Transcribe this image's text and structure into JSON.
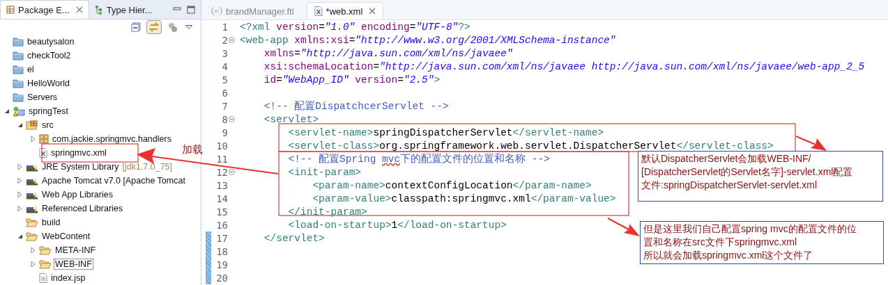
{
  "explorer": {
    "tabs": [
      {
        "label": "Package E...",
        "selected": true
      },
      {
        "label": "Type Hier...",
        "selected": false
      }
    ],
    "tree": [
      {
        "label": "beautysalon",
        "kind": "project"
      },
      {
        "label": "checkTool2",
        "kind": "project"
      },
      {
        "label": "el",
        "kind": "project"
      },
      {
        "label": "HelloWorld",
        "kind": "project"
      },
      {
        "label": "Servers",
        "kind": "project"
      },
      {
        "label": "springTest",
        "kind": "web-project",
        "expanded": true,
        "children": [
          {
            "label": "src",
            "kind": "source-folder",
            "expanded": true,
            "children": [
              {
                "label": "com.jackie.springmvc.handlers",
                "kind": "package",
                "expanded": false
              },
              {
                "label": "springmvc.xml",
                "kind": "xml-file"
              }
            ]
          },
          {
            "label": "JRE System Library",
            "decoration": "[jdk1.7.0_75]",
            "kind": "library",
            "expanded": false
          },
          {
            "label": "Apache Tomcat v7.0 [Apache Tomcat",
            "kind": "library",
            "expanded": false
          },
          {
            "label": "Web App Libraries",
            "kind": "library",
            "expanded": false
          },
          {
            "label": "Referenced Libraries",
            "kind": "library",
            "expanded": false
          },
          {
            "label": "build",
            "kind": "folder"
          },
          {
            "label": "WebContent",
            "kind": "folder",
            "expanded": true,
            "children": [
              {
                "label": "META-INF",
                "kind": "folder",
                "expanded": false
              },
              {
                "label": "WEB-INF",
                "kind": "folder",
                "expanded": false,
                "focused": true
              },
              {
                "label": "index.jsp",
                "kind": "jsp-file"
              }
            ]
          }
        ]
      }
    ]
  },
  "editor": {
    "tabs": [
      {
        "label": "brandManager.ftl",
        "selected": false,
        "kind": "ftl"
      },
      {
        "label": "*web.xml",
        "selected": true,
        "kind": "xml"
      }
    ],
    "lines": [
      {
        "number": "1",
        "tokens": [
          {
            "kind": "tag",
            "text": "<?xml"
          },
          {
            "kind": "attr",
            "text": " version"
          },
          {
            "kind": "text",
            "text": "="
          },
          {
            "kind": "value",
            "text": "\"1.0\""
          },
          {
            "kind": "attr",
            "text": " encoding"
          },
          {
            "kind": "text",
            "text": "="
          },
          {
            "kind": "value",
            "text": "\"UTF-8\""
          },
          {
            "kind": "tag",
            "text": "?>"
          }
        ]
      },
      {
        "number": "2",
        "fold": true,
        "tokens": [
          {
            "kind": "tag",
            "text": "<web-app"
          },
          {
            "kind": "attr",
            "text": " xmlns:xsi"
          },
          {
            "kind": "text",
            "text": "="
          },
          {
            "kind": "value",
            "text": "\"http://www.w3.org/2001/XMLSchema-instance\""
          }
        ]
      },
      {
        "number": "3",
        "tokens": [
          {
            "kind": "attr",
            "text": "    xmlns"
          },
          {
            "kind": "text",
            "text": "="
          },
          {
            "kind": "value",
            "text": "\"http://java.sun.com/xml/ns/javaee\""
          }
        ]
      },
      {
        "number": "4",
        "tokens": [
          {
            "kind": "attr",
            "text": "    xsi:schemaLocation"
          },
          {
            "kind": "text",
            "text": "="
          },
          {
            "kind": "value",
            "text": "\"http://java.sun.com/xml/ns/javaee http://java.sun.com/xml/ns/javaee/web-app_2_5"
          }
        ]
      },
      {
        "number": "5",
        "tokens": [
          {
            "kind": "attr",
            "text": "    id"
          },
          {
            "kind": "text",
            "text": "="
          },
          {
            "kind": "value",
            "text": "\"WebApp_ID\""
          },
          {
            "kind": "attr",
            "text": " version"
          },
          {
            "kind": "text",
            "text": "="
          },
          {
            "kind": "value",
            "text": "\"2.5\""
          },
          {
            "kind": "tag",
            "text": ">"
          }
        ]
      },
      {
        "number": "6"
      },
      {
        "number": "7",
        "tokens": [
          {
            "kind": "comment",
            "text": "    <!-- 配置DispatchcerServlet -->"
          }
        ]
      },
      {
        "number": "8",
        "fold": true,
        "tokens": [
          {
            "kind": "tag",
            "text": "    <servlet>"
          }
        ]
      },
      {
        "number": "9",
        "tokens": [
          {
            "kind": "tag",
            "text": "        <servlet-name>"
          },
          {
            "kind": "text",
            "text": "springDispatcherServlet"
          },
          {
            "kind": "tag",
            "text": "</servlet-name>"
          }
        ]
      },
      {
        "number": "10",
        "tokens": [
          {
            "kind": "tag",
            "text": "        <servlet-class>"
          },
          {
            "kind": "text",
            "text": "org.springframework.web.servlet.DispatcherServlet"
          },
          {
            "kind": "tag",
            "text": "</servlet-class>"
          }
        ]
      },
      {
        "number": "11",
        "tokens": [
          {
            "kind": "comment",
            "text": "        <!-- 配置Spring "
          },
          {
            "kind": "typo",
            "text": "mvc"
          },
          {
            "kind": "comment",
            "text": "下的配置文件的位置和名称 -->"
          }
        ]
      },
      {
        "number": "12",
        "fold": true,
        "tokens": [
          {
            "kind": "tag",
            "text": "        <init-param>"
          }
        ]
      },
      {
        "number": "13",
        "tokens": [
          {
            "kind": "tag",
            "text": "            <param-name>"
          },
          {
            "kind": "text",
            "text": "contextConfigLocation"
          },
          {
            "kind": "tag",
            "text": "</param-name>"
          }
        ]
      },
      {
        "number": "14",
        "tokens": [
          {
            "kind": "tag",
            "text": "            <param-value>"
          },
          {
            "kind": "text",
            "text": "classpath:springmvc.xml"
          },
          {
            "kind": "tag",
            "text": "</param-value>"
          }
        ]
      },
      {
        "number": "15",
        "tokens": [
          {
            "kind": "tag",
            "text": "        </init-param>"
          }
        ]
      },
      {
        "number": "16",
        "tokens": [
          {
            "kind": "tag",
            "text": "        <load-on-startup>"
          },
          {
            "kind": "text",
            "text": "1"
          },
          {
            "kind": "tag",
            "text": "</load-on-startup>"
          }
        ]
      },
      {
        "number": "17",
        "changed": true,
        "tokens": [
          {
            "kind": "tag",
            "text": "    </servlet>"
          }
        ]
      },
      {
        "number": "18",
        "changed": true
      },
      {
        "number": "19",
        "changed": true
      },
      {
        "number": "20",
        "changed": true
      }
    ]
  },
  "annotations": {
    "label": "加载",
    "notes": [
      {
        "lines": [
          "默认DispatcherServlet会加载WEB-INF/",
          "[DispatcherServlet的Servlet名字]-servlet.xml配置",
          "文件:springDispatcherServlet-servlet.xml"
        ]
      },
      {
        "lines": [
          "但是这里我们自己配置spring mvc的配置文件的位",
          "置和名称在src文件下springmvc.xml",
          "所以就会加载springmvc.xml这个文件了"
        ]
      }
    ]
  }
}
